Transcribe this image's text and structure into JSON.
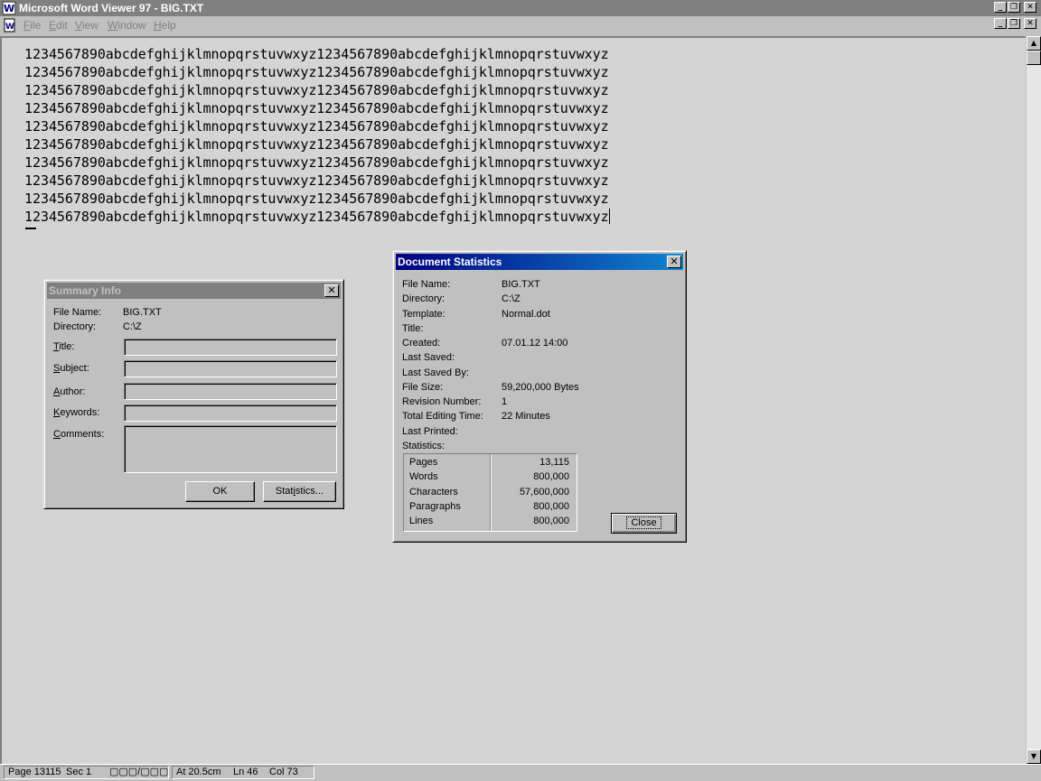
{
  "window": {
    "title": "Microsoft Word Viewer 97 - BIG.TXT",
    "icon": "word-viewer-app-icon"
  },
  "menu": {
    "items": [
      {
        "underline": "F",
        "rest": "ile"
      },
      {
        "underline": "E",
        "rest": "dit"
      },
      {
        "underline": "V",
        "rest": "iew"
      },
      {
        "underline": "W",
        "rest": "indow"
      },
      {
        "underline": "H",
        "rest": "elp"
      }
    ]
  },
  "document": {
    "lines": [
      "1234567890abcdefghijklmnopqrstuvwxyz1234567890abcdefghijklmnopqrstuvwxyz",
      "1234567890abcdefghijklmnopqrstuvwxyz1234567890abcdefghijklmnopqrstuvwxyz",
      "1234567890abcdefghijklmnopqrstuvwxyz1234567890abcdefghijklmnopqrstuvwxyz",
      "1234567890abcdefghijklmnopqrstuvwxyz1234567890abcdefghijklmnopqrstuvwxyz",
      "1234567890abcdefghijklmnopqrstuvwxyz1234567890abcdefghijklmnopqrstuvwxyz",
      "1234567890abcdefghijklmnopqrstuvwxyz1234567890abcdefghijklmnopqrstuvwxyz",
      "1234567890abcdefghijklmnopqrstuvwxyz1234567890abcdefghijklmnopqrstuvwxyz",
      "1234567890abcdefghijklmnopqrstuvwxyz1234567890abcdefghijklmnopqrstuvwxyz",
      "1234567890abcdefghijklmnopqrstuvwxyz1234567890abcdefghijklmnopqrstuvwxyz",
      "1234567890abcdefghijklmnopqrstuvwxyz1234567890abcdefghijklmnopqrstuvwxyz"
    ]
  },
  "summary_info": {
    "title": "Summary Info",
    "file_name_label": "File Name:",
    "file_name": "BIG.TXT",
    "directory_label": "Directory:",
    "directory": "C:\\Z",
    "title_label": {
      "underline": "T",
      "rest": "itle:"
    },
    "subject_label": {
      "underline": "S",
      "rest": "ubject:"
    },
    "author_label": {
      "underline": "A",
      "rest": "uthor:"
    },
    "keywords_label": {
      "underline": "K",
      "rest": "eywords:"
    },
    "comments_label": {
      "underline": "C",
      "rest": "omments:"
    },
    "title_value": "",
    "subject_value": "",
    "author_value": "",
    "keywords_value": "",
    "comments_value": "",
    "ok_label": "OK",
    "statistics_label": {
      "pre": "Stat",
      "underline": "i",
      "rest": "stics..."
    }
  },
  "doc_stats": {
    "title": "Document Statistics",
    "rows": [
      {
        "label": "File Name:",
        "value": "BIG.TXT"
      },
      {
        "label": "Directory:",
        "value": "C:\\Z"
      },
      {
        "label": "Template:",
        "value": "Normal.dot"
      },
      {
        "label": "Title:",
        "value": ""
      },
      {
        "label": "Created:",
        "value": "07.01.12 14:00"
      },
      {
        "label": "Last Saved:",
        "value": ""
      },
      {
        "label": "Last Saved By:",
        "value": ""
      },
      {
        "label": "File Size:",
        "value": "59,200,000 Bytes"
      },
      {
        "label": "Revision Number:",
        "value": "1"
      },
      {
        "label": "Total Editing Time:",
        "value": "22 Minutes"
      },
      {
        "label": "Last Printed:",
        "value": ""
      },
      {
        "label": "Statistics:",
        "value": ""
      }
    ],
    "stats": [
      {
        "label": "Pages",
        "value": "13,115"
      },
      {
        "label": "Words",
        "value": "800,000"
      },
      {
        "label": "Characters",
        "value": "57,600,000"
      },
      {
        "label": "Paragraphs",
        "value": "800,000"
      },
      {
        "label": "Lines",
        "value": "800,000"
      }
    ],
    "close_label": "Close"
  },
  "status": {
    "page": "Page  13115",
    "sec": "Sec  1",
    "page_of": "▢▢▢/▢▢▢",
    "at": "At  20.5cm",
    "ln": "Ln  46",
    "col": "Col  73"
  }
}
